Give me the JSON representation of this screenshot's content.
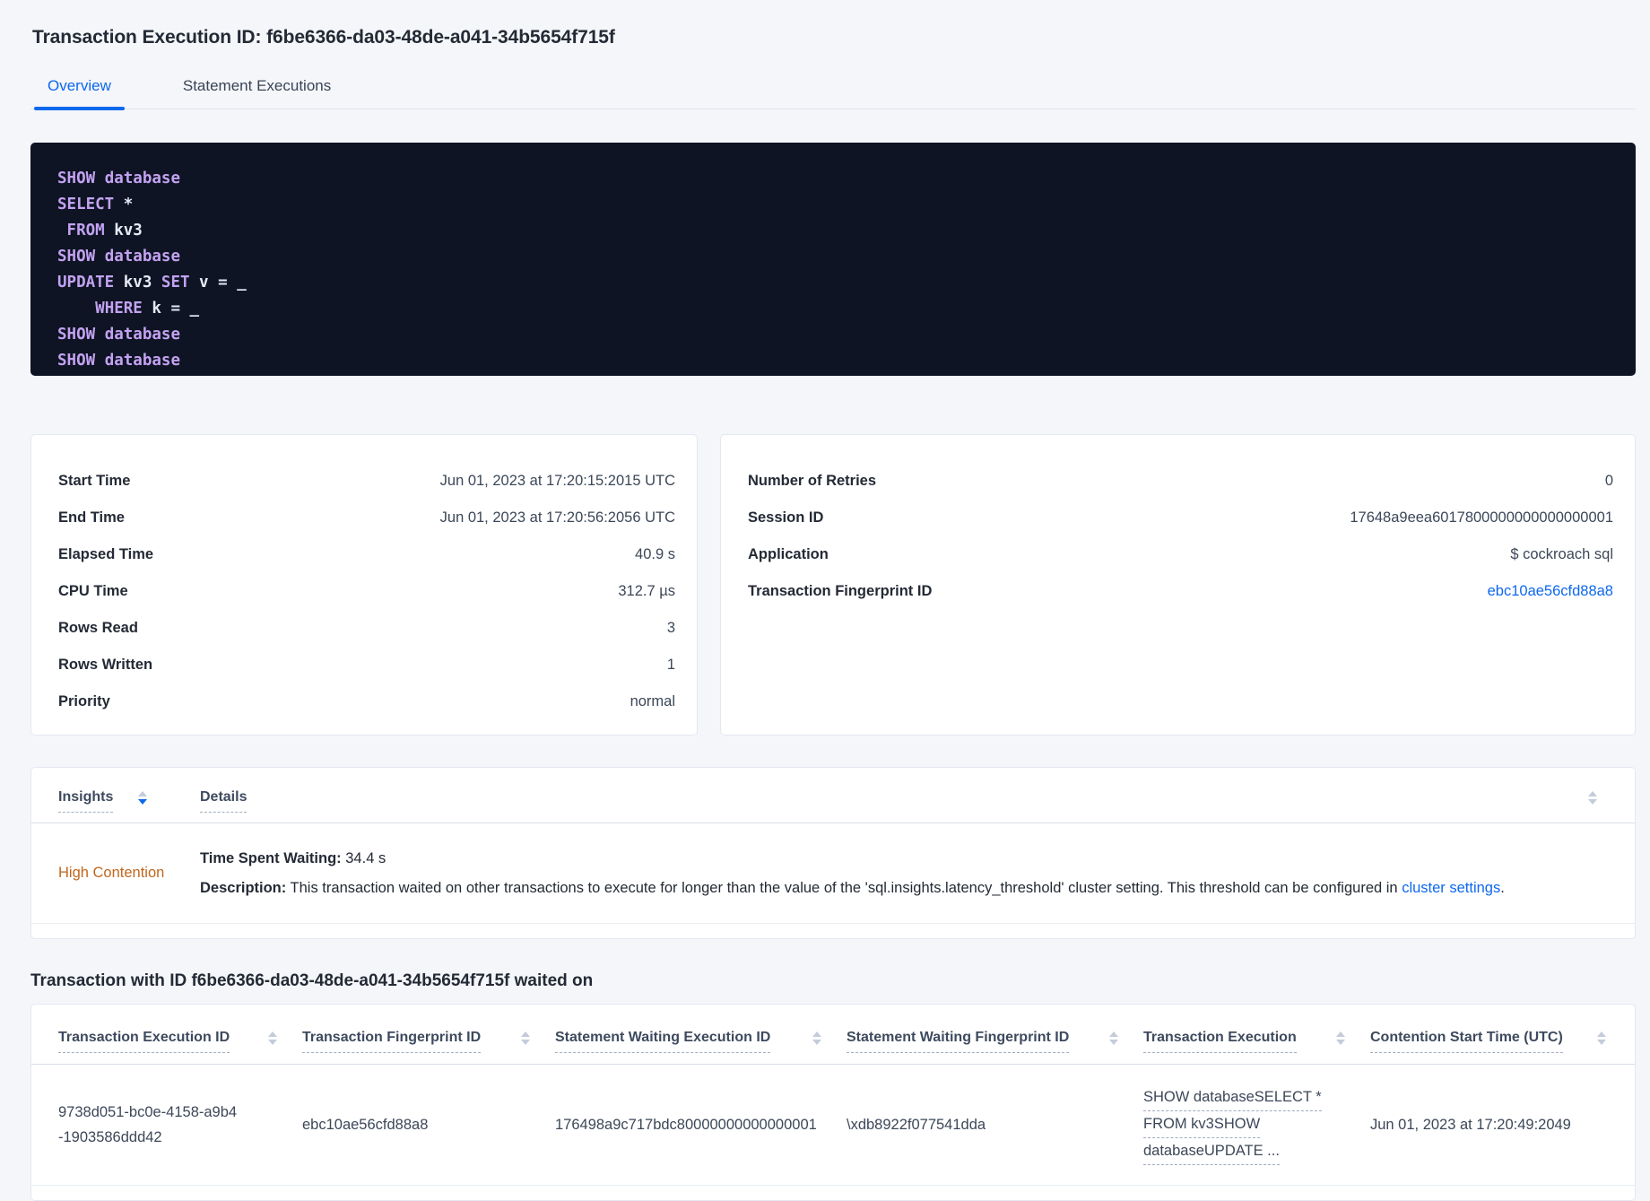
{
  "colors": {
    "accent_blue": "#0d68ee",
    "warning_orange": "#c2671c",
    "code_bg": "#0e1423",
    "code_keyword": "#c3a2f2",
    "code_plain": "#e4eaf4"
  },
  "header": {
    "title": "Transaction Execution ID: f6be6366-da03-48de-a041-34b5654f715f"
  },
  "tabs": [
    {
      "label": "Overview"
    },
    {
      "label": "Statement Executions"
    }
  ],
  "sql": {
    "lines": [
      [
        [
          "kw",
          "SHOW"
        ],
        [
          "pl",
          " "
        ],
        [
          "kw",
          "database"
        ]
      ],
      [
        [
          "kw",
          "SELECT"
        ],
        [
          "pl",
          " *"
        ]
      ],
      [
        [
          "pl",
          " "
        ],
        [
          "kw",
          "FROM"
        ],
        [
          "pl",
          " kv3"
        ]
      ],
      [
        [
          "kw",
          "SHOW"
        ],
        [
          "pl",
          " "
        ],
        [
          "kw",
          "database"
        ]
      ],
      [
        [
          "kw",
          "UPDATE"
        ],
        [
          "pl",
          " kv3 "
        ],
        [
          "kw",
          "SET"
        ],
        [
          "pl",
          " v = _"
        ]
      ],
      [
        [
          "pl",
          "    "
        ],
        [
          "kw",
          "WHERE"
        ],
        [
          "pl",
          " k = _"
        ]
      ],
      [
        [
          "kw",
          "SHOW"
        ],
        [
          "pl",
          " "
        ],
        [
          "kw",
          "database"
        ]
      ],
      [
        [
          "kw",
          "SHOW"
        ],
        [
          "pl",
          " "
        ],
        [
          "kw",
          "database"
        ]
      ]
    ]
  },
  "overview_card": {
    "rows": [
      {
        "label": "Start Time",
        "value": "Jun 01, 2023 at 17:20:15:2015 UTC"
      },
      {
        "label": "End Time",
        "value": "Jun 01, 2023 at 17:20:56:2056 UTC"
      },
      {
        "label": "Elapsed Time",
        "value": "40.9 s"
      },
      {
        "label": "CPU Time",
        "value": "312.7 µs"
      },
      {
        "label": "Rows Read",
        "value": "3"
      },
      {
        "label": "Rows Written",
        "value": "1"
      },
      {
        "label": "Priority",
        "value": "normal"
      }
    ]
  },
  "session_card": {
    "rows": [
      {
        "label": "Number of Retries",
        "value": "0"
      },
      {
        "label": "Session ID",
        "value": "17648a9eea6017800000000000000001"
      },
      {
        "label": "Application",
        "value": "$ cockroach sql"
      },
      {
        "label": "Transaction Fingerprint ID",
        "value": "ebc10ae56cfd88a8"
      }
    ]
  },
  "insights_table": {
    "columns": [
      "Insights",
      "Details"
    ],
    "row": {
      "insight": "High Contention",
      "waiting_label": "Time Spent Waiting:",
      "waiting_value": " 34.4 s",
      "description_label": "Description:",
      "description_text": " This transaction waited on other transactions to execute for longer than the value of the 'sql.insights.latency_threshold' cluster setting. This threshold can be configured in ",
      "description_link": "cluster settings",
      "description_suffix": "."
    }
  },
  "waited_section": {
    "title": "Transaction with ID f6be6366-da03-48de-a041-34b5654f715f waited on",
    "columns": [
      "Transaction Execution ID",
      "Transaction Fingerprint ID",
      "Statement Waiting Execution ID",
      "Statement Waiting Fingerprint ID",
      "Transaction Execution",
      "Contention Start Time (UTC)"
    ],
    "row": {
      "transaction_execution_id": "9738d051-bc0e-4158-a9b4-1903586ddd42",
      "transaction_fingerprint_id": "ebc10ae56cfd88a8",
      "statement_waiting_execution_id": "176498a9c717bdc80000000000000001",
      "statement_waiting_fingerprint_id": "\\xdb8922f077541dda",
      "transaction_execution_lines": [
        "SHOW databaseSELECT *",
        "FROM kv3SHOW",
        "databaseUPDATE ..."
      ],
      "contention_start_time": "Jun 01, 2023 at 17:20:49:2049"
    }
  }
}
